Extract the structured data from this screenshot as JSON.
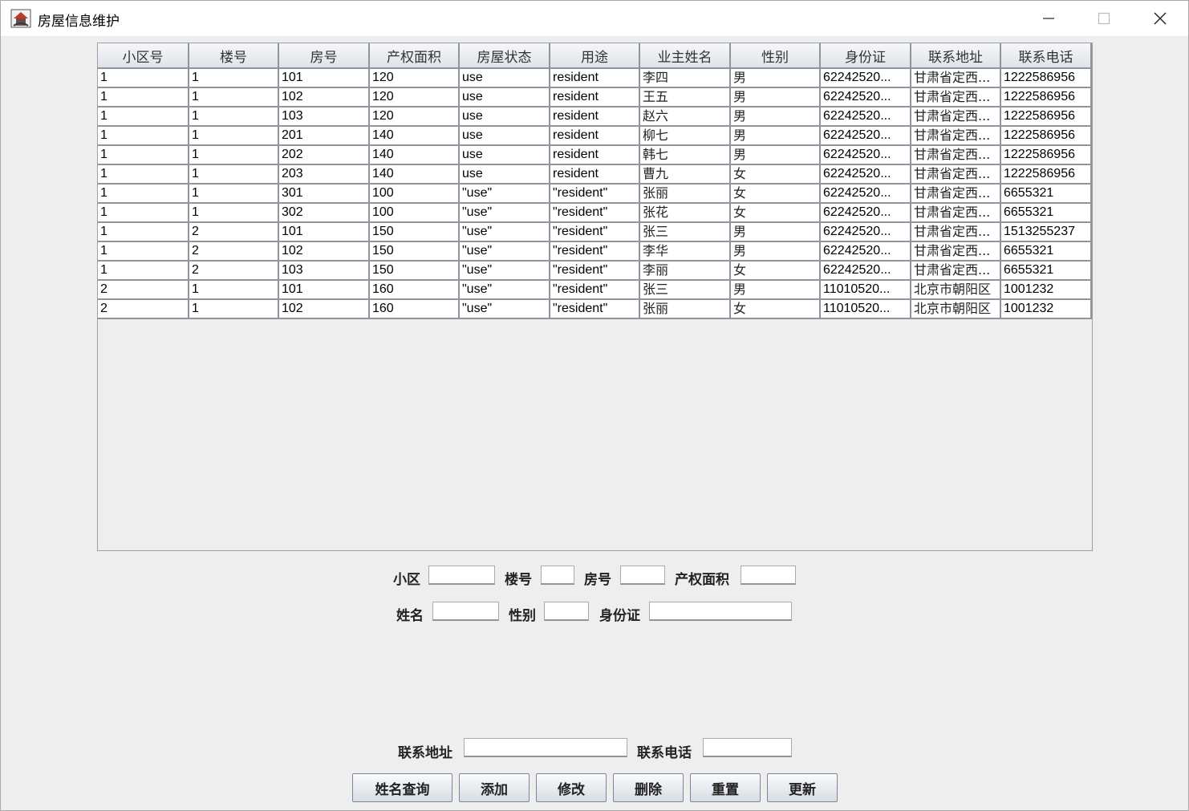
{
  "window": {
    "title": "房屋信息维护"
  },
  "table": {
    "columns": [
      "小区号",
      "楼号",
      "房号",
      "产权面积",
      "房屋状态",
      "用途",
      "业主姓名",
      "性别",
      "身份证",
      "联系地址",
      "联系电话"
    ],
    "rows": [
      [
        "1",
        "1",
        "101",
        "120",
        "use",
        "resident",
        "李四",
        "男",
        "62242520...",
        "甘肃省定西...",
        "1222586956"
      ],
      [
        "1",
        "1",
        "102",
        "120",
        "use",
        "resident",
        "王五",
        "男",
        "62242520...",
        "甘肃省定西...",
        "1222586956"
      ],
      [
        "1",
        "1",
        "103",
        "120",
        "use",
        "resident",
        "赵六",
        "男",
        "62242520...",
        "甘肃省定西...",
        "1222586956"
      ],
      [
        "1",
        "1",
        "201",
        "140",
        "use",
        "resident",
        "柳七",
        "男",
        "62242520...",
        "甘肃省定西...",
        "1222586956"
      ],
      [
        "1",
        "1",
        "202",
        "140",
        "use",
        "resident",
        "韩七",
        "男",
        "62242520...",
        "甘肃省定西...",
        "1222586956"
      ],
      [
        "1",
        "1",
        "203",
        "140",
        "use",
        "resident",
        "曹九",
        "女",
        "62242520...",
        "甘肃省定西...",
        "1222586956"
      ],
      [
        "1",
        "1",
        "301",
        "100",
        "\"use\"",
        "\"resident\"",
        "张丽",
        "女",
        "62242520...",
        "甘肃省定西...",
        "6655321"
      ],
      [
        "1",
        "1",
        "302",
        "100",
        "\"use\"",
        "\"resident\"",
        "张花",
        "女",
        "62242520...",
        "甘肃省定西...",
        "6655321"
      ],
      [
        "1",
        "2",
        "101",
        "150",
        "\"use\"",
        "\"resident\"",
        "张三",
        "男",
        "62242520...",
        "甘肃省定西...",
        "1513255237"
      ],
      [
        "1",
        "2",
        "102",
        "150",
        "\"use\"",
        "\"resident\"",
        "李华",
        "男",
        "62242520...",
        "甘肃省定西...",
        "6655321"
      ],
      [
        "1",
        "2",
        "103",
        "150",
        "\"use\"",
        "\"resident\"",
        "李丽",
        "女",
        "62242520...",
        "甘肃省定西...",
        "6655321"
      ],
      [
        "2",
        "1",
        "101",
        "160",
        "\"use\"",
        "\"resident\"",
        "张三",
        "男",
        "11010520...",
        "北京市朝阳区",
        "1001232"
      ],
      [
        "2",
        "1",
        "102",
        "160",
        "\"use\"",
        "\"resident\"",
        "张丽",
        "女",
        "11010520...",
        "北京市朝阳区",
        "1001232"
      ]
    ]
  },
  "form": {
    "community_label": "小区",
    "community_value": "",
    "building_label": "楼号",
    "building_value": "",
    "room_label": "房号",
    "room_value": "",
    "area_label": "产权面积",
    "area_value": "",
    "name_label": "姓名",
    "name_value": "",
    "gender_label": "性别",
    "gender_value": "",
    "id_label": "身份证",
    "id_value": "",
    "address_label": "联系地址",
    "address_value": "",
    "phone_label": "联系电话",
    "phone_value": ""
  },
  "buttons": {
    "query": "姓名查询",
    "add": "添加",
    "modify": "修改",
    "delete": "删除",
    "reset": "重置",
    "refresh": "更新"
  },
  "icons": {
    "app": "java-app-icon",
    "minimize": "minimize-icon",
    "maximize": "maximize-icon",
    "close": "close-icon"
  }
}
